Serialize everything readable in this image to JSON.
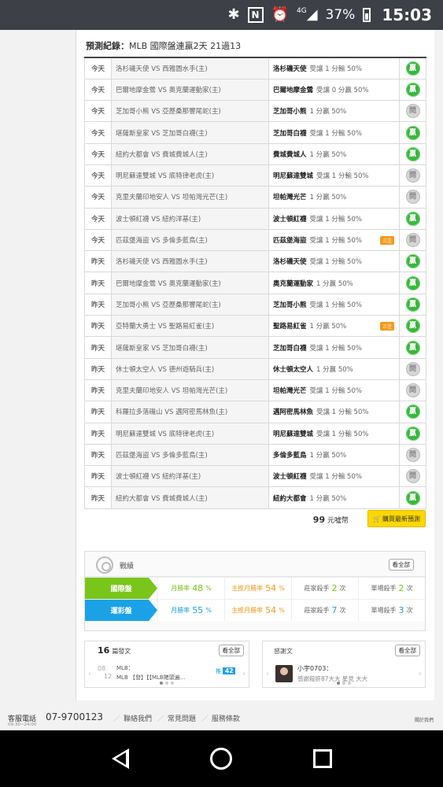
{
  "status_bar": {
    "network": "4G",
    "battery": "37%",
    "time": "15:03"
  },
  "record_header": {
    "label": "預測紀錄：",
    "summary": "MLB 國際盤連贏2天 21過13"
  },
  "records": [
    {
      "day": "今天",
      "match": "洛杉磯天使 VS 西雅圖水手(主)",
      "team": "洛杉磯天使",
      "odds": "受讓 1 分輸 50%",
      "tag": "",
      "result": "贏",
      "status": "win"
    },
    {
      "day": "今天",
      "match": "巴爾地摩金鶯 VS 奧克蘭運動家(主)",
      "team": "巴爾地摩金鶯",
      "odds": "受讓 0 分贏 50%",
      "tag": "",
      "result": "贏",
      "status": "win"
    },
    {
      "day": "今天",
      "match": "芝加哥小熊 VS 亞歷桑那響尾蛇(主)",
      "team": "芝加哥小熊",
      "odds": "1 分贏 50%",
      "tag": "",
      "result": "問",
      "status": "push"
    },
    {
      "day": "今天",
      "match": "堪薩斯皇家 VS 芝加哥白襪(主)",
      "team": "芝加哥白襪",
      "odds": "受讓 1 分輸 50%",
      "tag": "",
      "result": "贏",
      "status": "win"
    },
    {
      "day": "今天",
      "match": "紐約大都會 VS 費城費城人(主)",
      "team": "費城費城人",
      "odds": "1 分贏 50%",
      "tag": "",
      "result": "贏",
      "status": "win"
    },
    {
      "day": "今天",
      "match": "明尼蘇達雙城 VS 底特律老虎(主)",
      "team": "明尼蘇達雙城",
      "odds": "受讓 1 分輸 50%",
      "tag": "",
      "result": "問",
      "status": "push"
    },
    {
      "day": "今天",
      "match": "克里夫蘭印地安人 VS 坦帕灣光芒(主)",
      "team": "坦帕灣光芒",
      "odds": "1 分贏 50%",
      "tag": "",
      "result": "問",
      "status": "push"
    },
    {
      "day": "今天",
      "match": "波士頓紅襪 VS 紐約洋基(主)",
      "team": "波士頓紅襪",
      "odds": "受讓 1 分輸 50%",
      "tag": "",
      "result": "贏",
      "status": "win"
    },
    {
      "day": "今天",
      "match": "匹茲堡海盜 VS 多倫多藍鳥(主)",
      "team": "匹茲堡海盜",
      "odds": "受讓 1 分輸 50%",
      "tag": "三注",
      "result": "問",
      "status": "push"
    },
    {
      "day": "昨天",
      "match": "洛杉磯天使 VS 西雅圖水手(主)",
      "team": "洛杉磯天使",
      "odds": "受讓 1 分輸 50%",
      "tag": "",
      "result": "贏",
      "status": "win"
    },
    {
      "day": "昨天",
      "match": "巴爾地摩金鶯 VS 奧克蘭運動家(主)",
      "team": "奧克蘭運動家",
      "odds": "1 分贏 50%",
      "tag": "",
      "result": "贏",
      "status": "win"
    },
    {
      "day": "昨天",
      "match": "芝加哥小熊 VS 亞歷桑那響尾蛇(主)",
      "team": "芝加哥小熊",
      "odds": "受讓 1 分輸 50%",
      "tag": "",
      "result": "贏",
      "status": "win"
    },
    {
      "day": "昨天",
      "match": "亞特蘭大勇士 VS 聖路易紅雀(主)",
      "team": "聖路易紅雀",
      "odds": "1 分贏 50%",
      "tag": "三注",
      "result": "贏",
      "status": "win"
    },
    {
      "day": "昨天",
      "match": "堪薩斯皇家 VS 芝加哥白襪(主)",
      "team": "芝加哥白襪",
      "odds": "受讓 1 分輸 50%",
      "tag": "",
      "result": "贏",
      "status": "win"
    },
    {
      "day": "昨天",
      "match": "休士頓太空人 VS 德州遊騎兵(主)",
      "team": "休士頓太空人",
      "odds": "1 分贏 50%",
      "tag": "",
      "result": "問",
      "status": "push"
    },
    {
      "day": "昨天",
      "match": "克里夫蘭印地安人 VS 坦帕灣光芒(主)",
      "team": "坦帕灣光芒",
      "odds": "受讓 1 分輸 50%",
      "tag": "",
      "result": "問",
      "status": "push"
    },
    {
      "day": "昨天",
      "match": "科羅拉多落磯山 VS 邁阿密馬林魚(主)",
      "team": "邁阿密馬林魚",
      "odds": "受讓 1 分輸 50%",
      "tag": "",
      "result": "贏",
      "status": "win"
    },
    {
      "day": "昨天",
      "match": "明尼蘇達雙城 VS 底特律老虎(主)",
      "team": "明尼蘇達雙城",
      "odds": "受讓 1 分輸 50%",
      "tag": "",
      "result": "贏",
      "status": "win"
    },
    {
      "day": "昨天",
      "match": "匹茲堡海盜 VS 多倫多藍鳥(主)",
      "team": "多倫多藍鳥",
      "odds": "1 分贏 50%",
      "tag": "",
      "result": "問",
      "status": "push"
    },
    {
      "day": "昨天",
      "match": "波士頓紅襪 VS 紐約洋基(主)",
      "team": "波士頓紅襪",
      "odds": "受讓 1 分輸 50%",
      "tag": "",
      "result": "問",
      "status": "push"
    },
    {
      "day": "昨天",
      "match": "紐約大都會 VS 費城費城人(主)",
      "team": "紐約大都會",
      "odds": "1 分贏 50%",
      "tag": "",
      "result": "贏",
      "status": "win"
    }
  ],
  "purchase": {
    "price_num": "99",
    "price_unit": "元噓幣",
    "button_label": "購買最新預測"
  },
  "stats": {
    "title": "戰績",
    "view_all": "看全部",
    "rows": [
      {
        "label": "國際盤",
        "color": "green",
        "month_rate_label": "月勝率",
        "month_rate": "48",
        "month_rate_unit": "%",
        "home_rate_label": "主推月勝率",
        "home_rate": "54",
        "home_rate_unit": "%",
        "banker_label": "莊家殺手",
        "banker_count": "2",
        "banker_unit": "次",
        "single_label": "單場殺手",
        "single_count": "2",
        "single_unit": "次"
      },
      {
        "label": "運彩盤",
        "color": "blue",
        "month_rate_label": "月勝率",
        "month_rate": "55",
        "month_rate_unit": "%",
        "home_rate_label": "主推月勝率",
        "home_rate": "54",
        "home_rate_unit": "%",
        "banker_label": "莊家殺手",
        "banker_count": "7",
        "banker_unit": "次",
        "single_label": "單場殺手",
        "single_count": "3",
        "single_unit": "次"
      }
    ]
  },
  "posts": {
    "count": "16",
    "count_label": "篇發文",
    "view_all": "看全部",
    "date_month": "08",
    "date_day": "12",
    "title_line1": "MLB：",
    "title_line2": "MLB 【發】【【MLB賭頭遍...",
    "reply_label": "推",
    "reply_count": "42"
  },
  "thanks": {
    "title": "感謝文",
    "view_all": "看全部",
    "user": "小宇0703：",
    "message": "感謝殺肝87大大 星見 大大"
  },
  "footer": {
    "service_label": "客服電話",
    "hours": "09:30~24:00",
    "phone": "07-9700123",
    "links": [
      "聯絡我們",
      "常見問題",
      "服務條款"
    ],
    "about": "關於我們"
  }
}
